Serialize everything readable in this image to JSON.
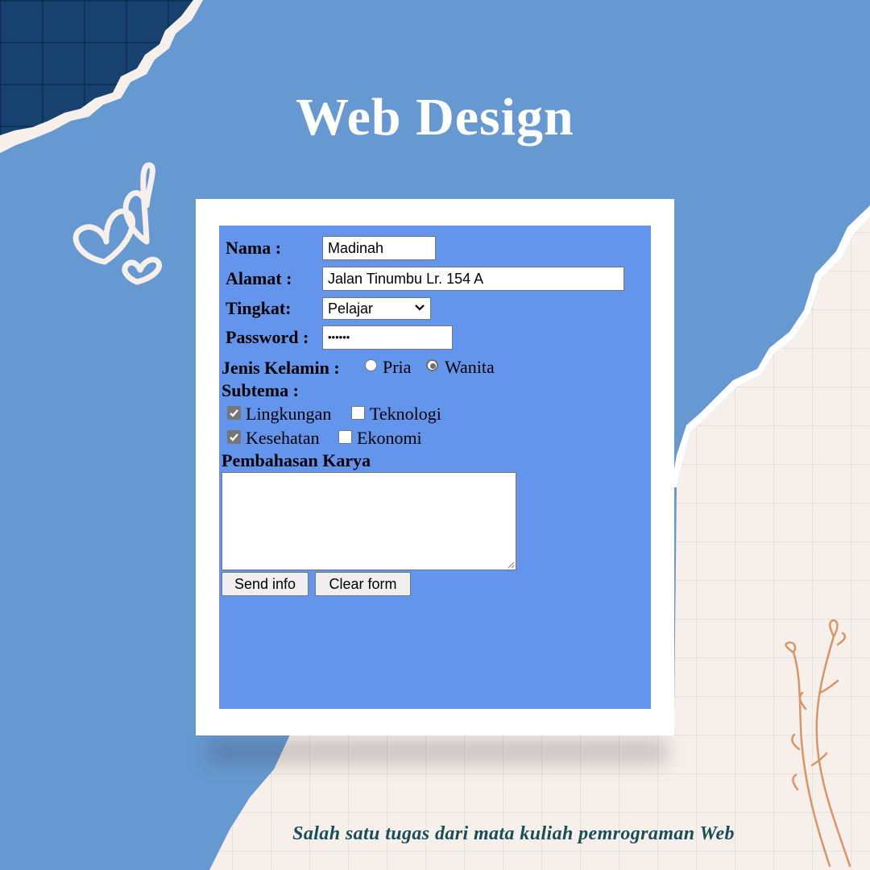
{
  "poster": {
    "title": "Web Design",
    "caption": "Salah satu tugas dari mata kuliah pemrograman Web"
  },
  "form": {
    "nama": {
      "label": "Nama :",
      "value": "Madinah"
    },
    "alamat": {
      "label": "Alamat :",
      "value": "Jalan Tinumbu Lr. 154 A"
    },
    "tingkat": {
      "label": "Tingkat:",
      "selected": "Pelajar"
    },
    "password": {
      "label": "Password :",
      "masked": "••••••"
    },
    "jenis_kelamin": {
      "label": "Jenis Kelamin :",
      "options": [
        {
          "label": "Pria",
          "checked": false
        },
        {
          "label": "Wanita",
          "checked": true
        }
      ]
    },
    "subtema": {
      "label": "Subtema :",
      "options": [
        {
          "label": "Lingkungan",
          "checked": true
        },
        {
          "label": "Teknologi",
          "checked": false
        },
        {
          "label": "Kesehatan",
          "checked": true
        },
        {
          "label": "Ekonomi",
          "checked": false
        }
      ]
    },
    "pembahasan": {
      "label": "Pembahasan Karya",
      "value": ""
    },
    "buttons": {
      "send": "Send info",
      "clear": "Clear form"
    }
  },
  "colors": {
    "background": "#6699d1",
    "corner_navy": "#17416f",
    "paper": "#f7efe9",
    "form_background": "#6495ed",
    "caption_text": "#184e58",
    "floral": "#d9956a"
  },
  "icons": [
    "heart-doodle-icon",
    "floral-sprig-icon",
    "chevron-down-icon",
    "checkmark-icon",
    "resize-grip-icon"
  ]
}
